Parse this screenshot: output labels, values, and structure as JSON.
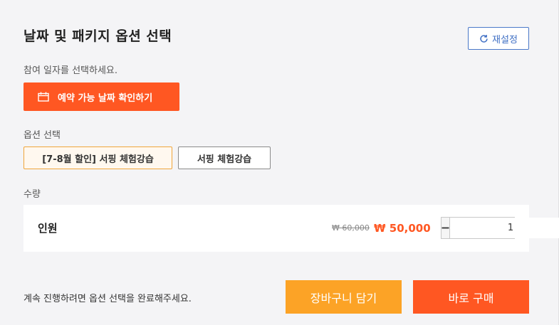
{
  "header": {
    "title": "날짜 및 패키지 옵션 선택",
    "reset_label": "재설정"
  },
  "date": {
    "instruction": "참여 일자를 선택하세요.",
    "button_label": "예약 가능 날짜 확인하기"
  },
  "options": {
    "label": "옵션 선택",
    "items": [
      {
        "label": "[7-8월 할인] 서핑 체험강습",
        "selected": true
      },
      {
        "label": "서핑 체험강습",
        "selected": false
      }
    ]
  },
  "quantity": {
    "label": "수량",
    "row": {
      "name": "인원",
      "original_price": "₩ 60,000",
      "price": "₩ 50,000",
      "count": "1"
    }
  },
  "footer": {
    "message": "계속 진행하려면 옵션 선택을 완료해주세요.",
    "cart_label": "장바구니 담기",
    "buy_label": "바로 구매"
  },
  "colors": {
    "accent": "#ff5722",
    "cart": "#fca326",
    "link": "#3f6fc4"
  }
}
